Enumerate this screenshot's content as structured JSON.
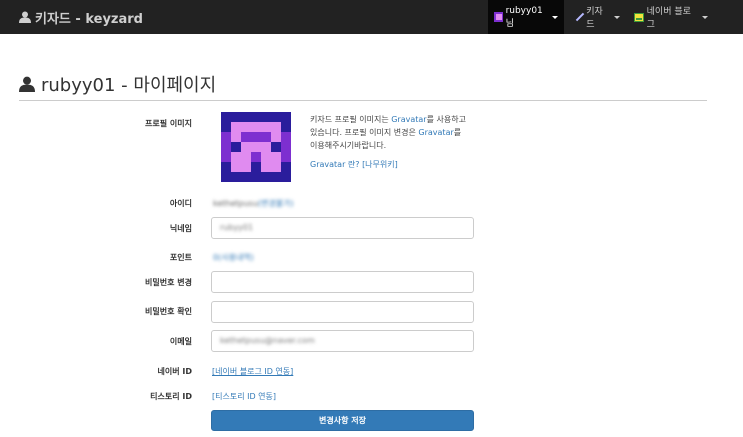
{
  "navbar": {
    "brand": "키자드 - keyzard",
    "user_menu": "rubyy01 님",
    "keyzard_menu": "키자드",
    "naver_menu": "네이버 블로그"
  },
  "page": {
    "title": "rubyy01 - 마이페이지"
  },
  "profile": {
    "label": "프로필 이미지",
    "desc_part1": "키자드 프로필 이미지는 ",
    "gravatar": "Gravatar",
    "desc_part2": "를 사용하고 있습니다. 프로필 이미지 변경은 ",
    "desc_part3": "를 이용해주시기바랍니다.",
    "gravatar_what": "Gravatar 란?",
    "namuwiki": "[나무위키]"
  },
  "form": {
    "id_label": "아이디",
    "id_value": "kethetpusu",
    "id_suffix": "(변경불가)",
    "nickname_label": "닉네임",
    "nickname_value": "rubyy01",
    "point_label": "포인트",
    "point_value": "0(사용내역)",
    "pw_change_label": "비밀번호 변경",
    "pw_confirm_label": "비밀번호 확인",
    "email_label": "이메일",
    "email_value": "kethetpusu@naver.com",
    "naver_label": "네이버 ID",
    "naver_link": "[네이버 블로그 ID 연동]",
    "tistory_label": "티스토리 ID",
    "tistory_link": "[티스토리 ID 연동]",
    "save_label": "변경사항 저장"
  },
  "colors": {
    "navbar_bg": "#222222",
    "primary": "#337ab7",
    "avatar_bg": "#2a1d9c",
    "avatar_fg": "#e08bf0"
  }
}
